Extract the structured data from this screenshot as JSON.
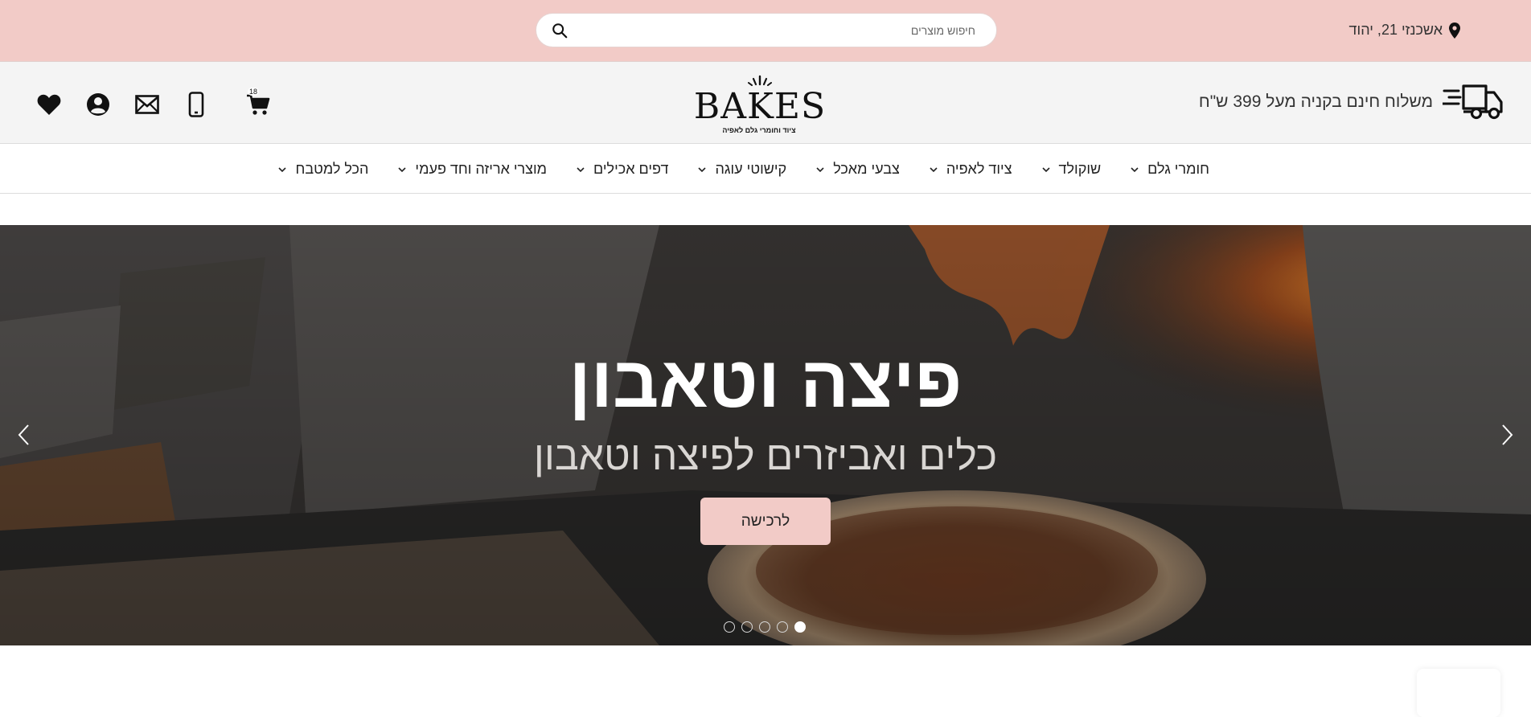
{
  "topbar": {
    "address": "אשכנזי 21, יהוד",
    "search_placeholder": "חיפוש מוצרים",
    "icons": [
      "map-pin-icon",
      "search-icon"
    ]
  },
  "header": {
    "shipping_text": "משלוח חינם בקניה מעל 399 ש\"ח",
    "logo_text": "BAKES",
    "logo_tagline": "ציוד וחומרי גלם לאפיה",
    "cart_count": "18",
    "icons": [
      "delivery-truck-icon",
      "cart-icon",
      "phone-icon",
      "mail-icon",
      "account-icon",
      "heart-icon"
    ]
  },
  "nav": {
    "items": [
      {
        "label": "חומרי גלם"
      },
      {
        "label": "שוקולד"
      },
      {
        "label": "ציוד לאפיה"
      },
      {
        "label": "צבעי מאכל"
      },
      {
        "label": "קישוטי עוגה"
      },
      {
        "label": "דפים אכילים"
      },
      {
        "label": "מוצרי אריזה וחד פעמי"
      },
      {
        "label": "הכל למטבח"
      }
    ]
  },
  "hero": {
    "title": "פיצה וטאבון",
    "subtitle": "כלים ואביזרים לפיצה וטאבון",
    "button_label": "לרכישה",
    "slide_count": 5,
    "active_slide": 5
  },
  "colors": {
    "accent_pink": "#f2cbc7",
    "header_bg": "#f4f4f4"
  }
}
